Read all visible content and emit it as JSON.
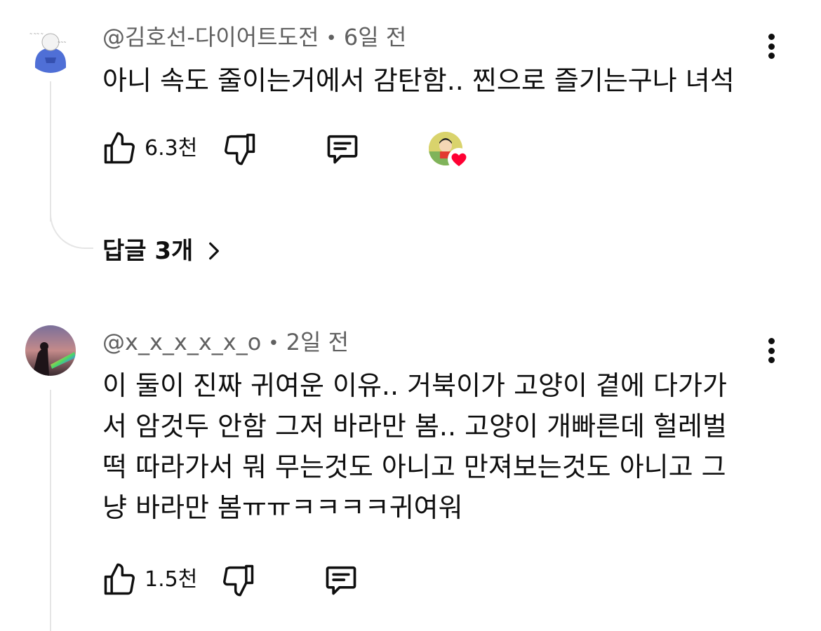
{
  "comments": [
    {
      "author": "@김호선-다이어트도전",
      "separator": "•",
      "time": "6일 전",
      "text": "아니 속도 줄이는거에서 감탄함.. 찐으로 즐기는구나 녀석",
      "likes": "6.3천",
      "creator_heart": true,
      "replies_label": "답글 3개"
    },
    {
      "author": "@x_x_x_x_x_o",
      "separator": "•",
      "time": "2일 전",
      "text": "이 둘이 진짜 귀여운 이유.. 거북이가 고양이 곁에 다가가\n서 암것두 안함 그저 바라만 봄.. 고양이 개빠른데 헐레벌\n떡 따라가서 뭐 무는것도 아니고 만져보는것도 아니고 그\n냥 바라만 봄ㅠㅠㅋㅋㅋㅋ귀여워",
      "likes": "1.5천",
      "creator_heart": false
    }
  ],
  "icons": {
    "like": "thumbs-up-icon",
    "dislike": "thumbs-down-icon",
    "reply": "comment-reply-icon",
    "more": "vertical-dots-icon",
    "chevron": "chevron-right-icon"
  },
  "colors": {
    "text_primary": "#0f0f0f",
    "text_secondary": "#606060",
    "heart": "#ff0033",
    "thread_line": "#e5e5e5"
  }
}
